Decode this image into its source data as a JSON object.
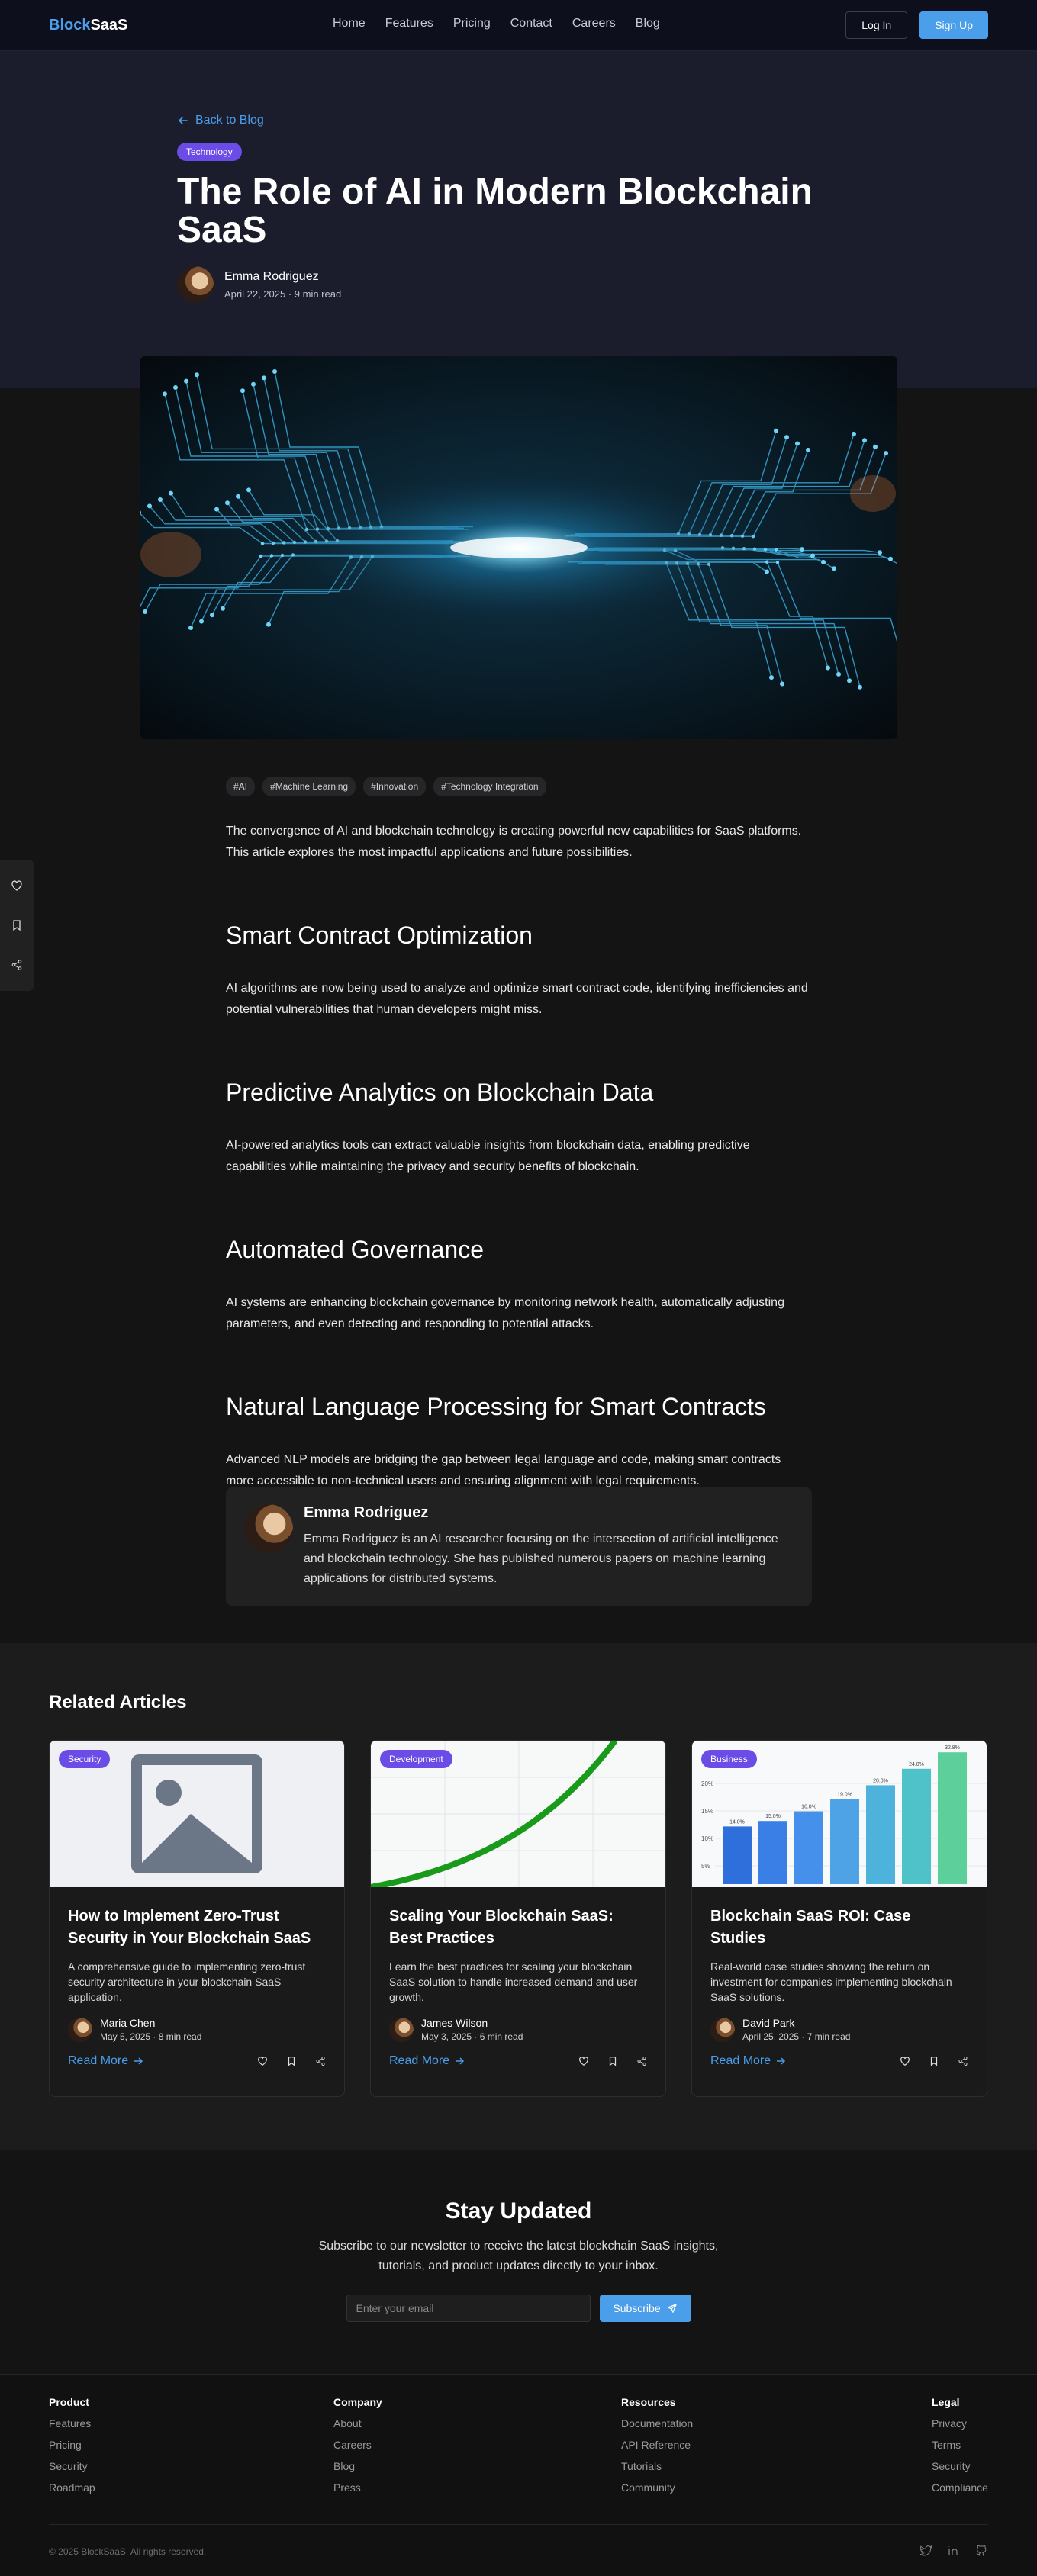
{
  "nav": {
    "logo_part1": "Block",
    "logo_part2": "SaaS",
    "links": [
      "Home",
      "Features",
      "Pricing",
      "Contact",
      "Careers",
      "Blog"
    ],
    "login": "Log In",
    "signup": "Sign Up"
  },
  "hero": {
    "back": "Back to Blog",
    "category": "Technology",
    "title": "The Role of AI in Modern Blockchain SaaS",
    "author": "Emma Rodriguez",
    "meta": "April 22, 2025 · 9 min read"
  },
  "article": {
    "tags": [
      "#AI",
      "#Machine Learning",
      "#Innovation",
      "#Technology Integration"
    ],
    "intro": "The convergence of AI and blockchain technology is creating powerful new capabilities for SaaS platforms. This article explores the most impactful applications and future possibilities.",
    "sections": [
      {
        "heading": "Smart Contract Optimization",
        "text": "AI algorithms are now being used to analyze and optimize smart contract code, identifying inefficiencies and potential vulnerabilities that human developers might miss."
      },
      {
        "heading": "Predictive Analytics on Blockchain Data",
        "text": "AI-powered analytics tools can extract valuable insights from blockchain data, enabling predictive capabilities while maintaining the privacy and security benefits of blockchain."
      },
      {
        "heading": "Automated Governance",
        "text": "AI systems are enhancing blockchain governance by monitoring network health, automatically adjusting parameters, and even detecting and responding to potential attacks."
      },
      {
        "heading": "Natural Language Processing for Smart Contracts",
        "text": "Advanced NLP models are bridging the gap between legal language and code, making smart contracts more accessible to non-technical users and ensuring alignment with legal requirements."
      }
    ],
    "author_box": {
      "name": "Emma Rodriguez",
      "bio": "Emma Rodriguez is an AI researcher focusing on the intersection of artificial intelligence and blockchain technology. She has published numerous papers on machine learning applications for distributed systems."
    }
  },
  "related": {
    "heading": "Related Articles",
    "cards": [
      {
        "category": "Security",
        "title": "How to Implement Zero-Trust Security in Your Blockchain SaaS",
        "desc": "A comprehensive guide to implementing zero-trust security architecture in your blockchain SaaS application.",
        "author": "Maria Chen",
        "meta": "May 5, 2025 · 8 min read",
        "read_more": "Read More"
      },
      {
        "category": "Development",
        "title": "Scaling Your Blockchain SaaS: Best Practices",
        "desc": "Learn the best practices for scaling your blockchain SaaS solution to handle increased demand and user growth.",
        "author": "James Wilson",
        "meta": "May 3, 2025 · 6 min read",
        "read_more": "Read More"
      },
      {
        "category": "Business",
        "title": "Blockchain SaaS ROI: Case Studies",
        "desc": "Real-world case studies showing the return on investment for companies implementing blockchain SaaS solutions.",
        "author": "David Park",
        "meta": "April 25, 2025 · 7 min read",
        "read_more": "Read More"
      }
    ],
    "roi_chart": {
      "y_ticks": [
        "20%",
        "15%",
        "10%",
        "5%"
      ],
      "bar_labels": [
        "14.0%",
        "15.0%",
        "16.0%",
        "19.0%",
        "20.0%",
        "24.0%",
        "32.8%"
      ],
      "values": [
        0.42,
        0.46,
        0.53,
        0.62,
        0.72,
        0.84,
        0.96
      ],
      "colors": [
        "#2f6fdc",
        "#3a7fe6",
        "#4590ea",
        "#4ea3e6",
        "#4eb3dc",
        "#4fc1c9",
        "#5ccf9a"
      ]
    }
  },
  "newsletter": {
    "title": "Stay Updated",
    "text": "Subscribe to our newsletter to receive the latest blockchain SaaS insights, tutorials, and product updates directly to your inbox.",
    "placeholder": "Enter your email",
    "button": "Subscribe"
  },
  "footer": {
    "product": {
      "title": "Product",
      "links": [
        "Features",
        "Pricing",
        "Security",
        "Roadmap"
      ]
    },
    "company": {
      "title": "Company",
      "links": [
        "About",
        "Careers",
        "Blog",
        "Press"
      ]
    },
    "resources": {
      "title": "Resources",
      "links": [
        "Documentation",
        "API Reference",
        "Tutorials",
        "Community"
      ]
    },
    "legal": {
      "title": "Legal",
      "links": [
        "Privacy",
        "Terms",
        "Security",
        "Compliance"
      ]
    },
    "copyright": "© 2025 BlockSaaS. All rights reserved."
  }
}
